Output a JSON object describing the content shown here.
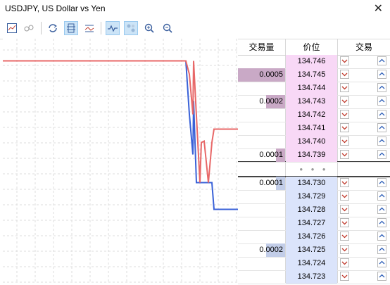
{
  "window": {
    "title": "USDJPY, US Dollar vs Yen",
    "close": "✕"
  },
  "toolbar": {
    "tools": [
      {
        "icon": "chart-view-icon",
        "active": false
      },
      {
        "icon": "ticks-icon",
        "active": false
      },
      {
        "icon": "sync-icon",
        "active": false
      },
      {
        "icon": "one-click-trading-icon",
        "active": true
      },
      {
        "icon": "levels-icon",
        "active": false
      },
      {
        "icon": "tick-chart-icon",
        "active": true
      },
      {
        "icon": "trades-icon",
        "active": true
      },
      {
        "icon": "zoom-in-icon",
        "active": false
      },
      {
        "icon": "zoom-out-icon",
        "active": false
      }
    ]
  },
  "depth": {
    "headers": {
      "volume": "交易量",
      "price": "价位",
      "trade": "交易"
    },
    "asks": [
      {
        "price": "134.746",
        "volume": "",
        "depth": 0
      },
      {
        "price": "134.745",
        "volume": "0.0005",
        "depth": 1.0
      },
      {
        "price": "134.744",
        "volume": "",
        "depth": 0
      },
      {
        "price": "134.743",
        "volume": "0.0002",
        "depth": 0.4
      },
      {
        "price": "134.742",
        "volume": "",
        "depth": 0
      },
      {
        "price": "134.741",
        "volume": "",
        "depth": 0
      },
      {
        "price": "134.740",
        "volume": "",
        "depth": 0
      },
      {
        "price": "134.739",
        "volume": "0.0001",
        "depth": 0.2
      }
    ],
    "spread_marker": "• • •",
    "bids": [
      {
        "price": "134.730",
        "volume": "0.0001",
        "depth": 0.2
      },
      {
        "price": "134.729",
        "volume": "",
        "depth": 0
      },
      {
        "price": "134.728",
        "volume": "",
        "depth": 0
      },
      {
        "price": "134.727",
        "volume": "",
        "depth": 0
      },
      {
        "price": "134.726",
        "volume": "",
        "depth": 0
      },
      {
        "price": "134.725",
        "volume": "0.0002",
        "depth": 0.4
      },
      {
        "price": "134.724",
        "volume": "",
        "depth": 0
      },
      {
        "price": "134.723",
        "volume": "",
        "depth": 0
      }
    ],
    "colors": {
      "ask": "#f8d8f6",
      "bid": "#dbe4fb",
      "ask_vol": "#c9a9c6",
      "bid_vol": "#c2cde8"
    }
  },
  "tick_chart": {
    "ask_color": "#e86868",
    "bid_color": "#3a62d8",
    "ask": [
      134.746,
      134.746,
      134.746,
      134.746,
      134.746,
      134.746,
      134.746,
      134.746,
      134.746,
      134.746,
      134.746,
      134.746,
      134.746,
      134.746,
      134.746,
      134.746,
      134.746,
      134.745,
      134.742,
      134.746,
      134.735,
      134.73,
      134.733,
      134.74,
      134.73,
      134.733,
      134.734,
      134.734,
      134.734,
      134.734,
      134.734
    ],
    "bid": [
      134.746,
      134.746,
      134.746,
      134.746,
      134.746,
      134.746,
      134.746,
      134.746,
      134.746,
      134.746,
      134.746,
      134.746,
      134.746,
      134.746,
      134.746,
      134.746,
      134.746,
      134.742,
      134.739,
      134.743,
      134.73,
      134.73,
      134.73,
      134.73,
      134.73,
      134.73,
      134.728,
      134.728,
      134.728,
      134.728,
      134.728
    ]
  }
}
